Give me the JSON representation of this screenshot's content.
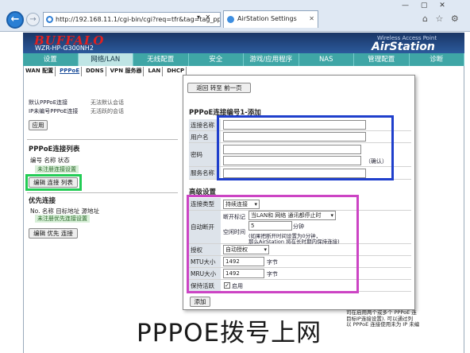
{
  "browser": {
    "url": "http://192.168.11.1/cgi-bin/cgi?req=tfr&tag=tag_ppp",
    "tab_title": "AirStation Settings",
    "addr_controls": "▾ ✕",
    "win_controls": "— ▢ ✕",
    "tool_icons": "⌂ ☆ ⚙"
  },
  "header": {
    "logo": "BUFFALO",
    "model": "WZR-HP-G300NH2",
    "tagline": "Wireless Access Point",
    "product": "AirStation"
  },
  "nav": [
    "设置",
    "网络/LAN",
    "无线配置",
    "安全",
    "游戏/应用程序",
    "NAS",
    "管理配置",
    "诊断"
  ],
  "subnav": [
    "WAN 配置",
    "PPPoE",
    "DDNS",
    "VPN 服务器",
    "LAN",
    "DHCP"
  ],
  "left": {
    "default_label": "默认PPPoE连接",
    "default_value": "无法默认会话",
    "ip_label": "IP未编号PPPoE连接",
    "ip_value": "无活跃的会话",
    "apply": "应用",
    "list_title": "PPPoE连接列表",
    "list_headers": "编号  名称  状态",
    "list_empty": "未注册连接设置",
    "edit_list_btn": "编辑 连接 列表",
    "prio_title": "优先连接",
    "prio_headers": "No.  名称  目标地址  源地址",
    "prio_empty": "未注册优先连接设置",
    "edit_prio_btn": "编辑 优先 连接"
  },
  "dialog": {
    "back_btn": "返回 转至 前一页",
    "title": "PPPoE连接编号1-添加",
    "fields": [
      "连接名称",
      "用户名",
      "密码",
      "服务名称"
    ],
    "confirm": "（确认）",
    "adv_title": "高级设置",
    "conn_type_label": "连接类型",
    "conn_type_value": "持续连接",
    "auto_disc_label": "自动断开",
    "disc_mark_label": "断开标记",
    "disc_mark_value": "当LAN和 网络 通讯都停止时",
    "idle_label": "空闲时间",
    "idle_value": "5",
    "idle_unit": "分钟",
    "idle_note1": "(如果把断开时间设置为0分钟，",
    "idle_note2": "那么AirStation 将在长时期内保持连接)",
    "auth_label": "授权",
    "auth_value": "自动授权",
    "mtu_label": "MTU大小",
    "mtu_value": "1492",
    "mru_label": "MRU大小",
    "mru_value": "1492",
    "unit": "字节",
    "keepalive_label": "保持活跃",
    "keepalive_value": "启用",
    "add_btn": "添加"
  },
  "right_panel": [
    "司在启用两个或多个 PPPoE 连",
    "目标IP连接设置). 可以通过列",
    "以 PPPoE 连接使用未为 IP 未编"
  ],
  "caption": "PPPOE拨号上网",
  "highlights": {
    "green": "#22cc55",
    "blue": "#1f3fcc",
    "magenta": "#cc44c4"
  }
}
